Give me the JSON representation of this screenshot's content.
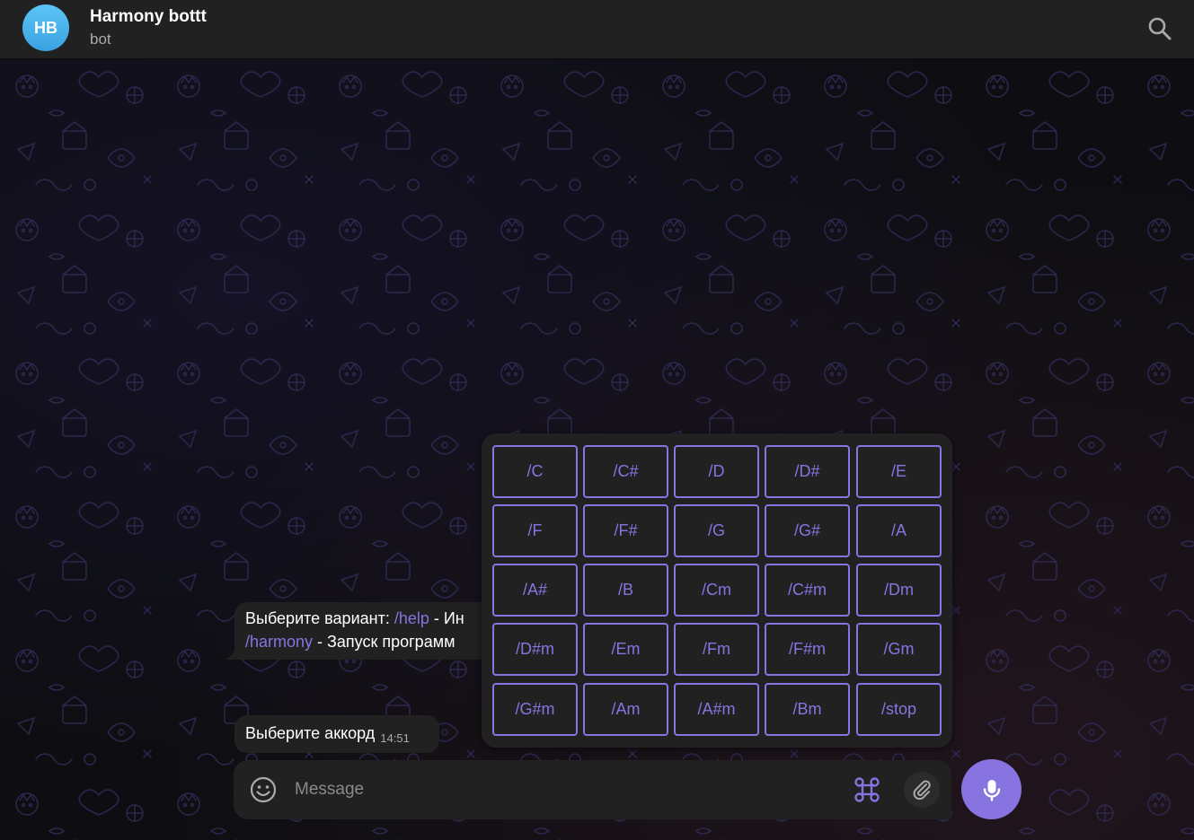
{
  "header": {
    "avatar_initials": "HB",
    "title": "Harmony bottt",
    "subtitle": "bot"
  },
  "messages": [
    {
      "prefix": "Выберите вариант: ",
      "cmd1": "/help",
      "mid": " - Ин",
      "cmd2": "/harmony",
      "suffix": " - Запуск программ"
    },
    {
      "text": "Выберите аккорд",
      "time": "14:51"
    }
  ],
  "keyboard": {
    "rows": [
      [
        "/C",
        "/C#",
        "/D",
        "/D#",
        "/E"
      ],
      [
        "/F",
        "/F#",
        "/G",
        "/G#",
        "/A"
      ],
      [
        "/A#",
        "/B",
        "/Cm",
        "/C#m",
        "/Dm"
      ],
      [
        "/D#m",
        "/Em",
        "/Fm",
        "/F#m",
        "/Gm"
      ],
      [
        "/G#m",
        "/Am",
        "/A#m",
        "/Bm",
        "/stop"
      ]
    ]
  },
  "composer": {
    "placeholder": "Message"
  },
  "icons": {
    "search": "search-icon",
    "emoji": "emoji-icon",
    "commands": "command-icon",
    "attach": "paperclip-icon",
    "mic": "microphone-icon"
  },
  "colors": {
    "accent": "#8774e1",
    "panel": "#212121",
    "avatar": "#4fb3ef"
  }
}
